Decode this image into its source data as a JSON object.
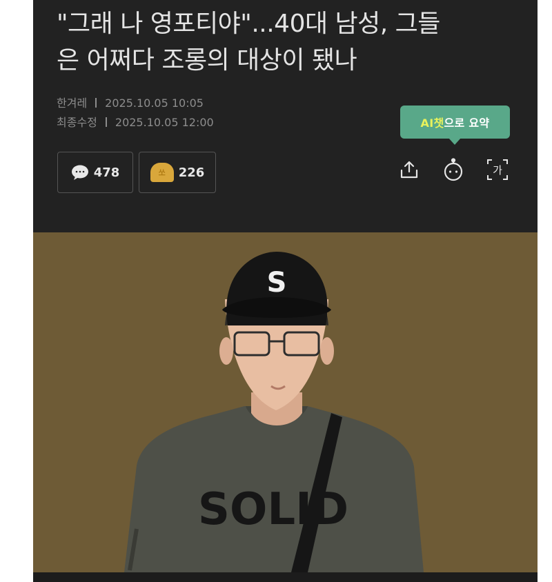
{
  "article": {
    "title_line1": "\"그래 나 영포티야\"...40대 남성, 그들",
    "title_line2": "은 어쩌다 조롱의 대상이 됐나",
    "source": "한겨레",
    "published": "2025.10.05 10:05",
    "modified_label": "최종수정",
    "modified": "2025.10.05 12:00"
  },
  "actions": {
    "comment_count": "478",
    "reaction_count": "226",
    "reaction_coin_text": "쏘"
  },
  "ai_summary": {
    "label_highlight": "AI챗",
    "label_rest": "으로 요약"
  },
  "toolbar": {
    "font_icon_text": "가"
  },
  "hero": {
    "cap_letter": "S",
    "shirt_text": "SOLID"
  },
  "colors": {
    "background": "#222222",
    "accent": "#59a889",
    "hero_bg": "#6e5b36"
  },
  "icons": [
    "comment-icon",
    "coin-icon",
    "share-icon",
    "ai-bot-icon",
    "font-size-icon"
  ]
}
